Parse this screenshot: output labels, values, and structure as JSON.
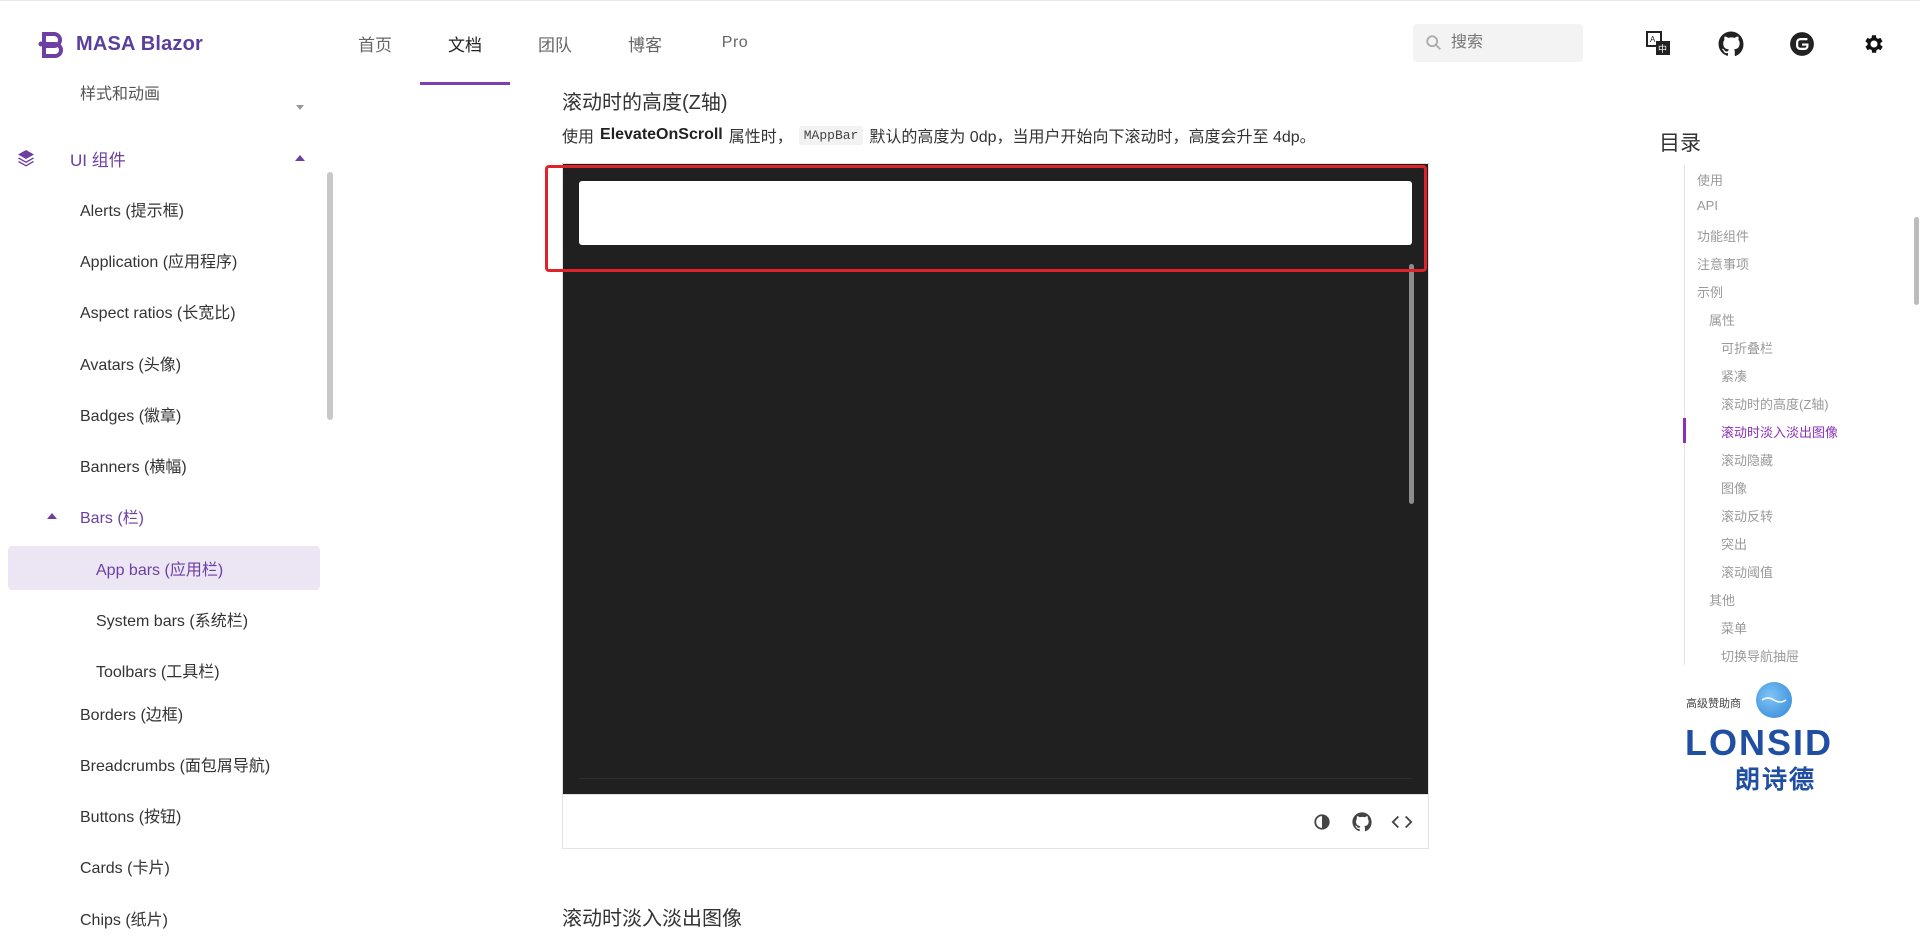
{
  "header": {
    "logo_text": "MASA Blazor",
    "nav": [
      {
        "label": "首页",
        "active": false
      },
      {
        "label": "文档",
        "active": true
      },
      {
        "label": "团队",
        "active": false
      },
      {
        "label": "博客",
        "active": false
      },
      {
        "label": "Pro",
        "active": false
      }
    ],
    "search_placeholder": "搜索",
    "icons": [
      "translate-icon",
      "github-icon",
      "gitee-icon",
      "gear-icon"
    ],
    "accent_color": "#7a3fb3"
  },
  "sidebar": {
    "partial_item": "样式和动画",
    "group": {
      "label": "UI 组件",
      "expanded": true
    },
    "items": [
      "Alerts (提示框)",
      "Application (应用程序)",
      "Aspect ratios (长宽比)",
      "Avatars (头像)",
      "Badges (徽章)",
      "Banners (横幅)"
    ],
    "bars": {
      "label": "Bars (栏)",
      "children": [
        "App bars (应用栏)",
        "System bars (系统栏)",
        "Toolbars (工具栏)"
      ],
      "selected": "App bars (应用栏)"
    },
    "items_after": [
      "Borders (边框)",
      "Breadcrumbs (面包屑导航)",
      "Buttons (按钮)",
      "Cards (卡片)",
      "Chips (纸片)"
    ]
  },
  "main": {
    "section_title": "滚动时的高度(Z轴)",
    "desc_prefix": "使用",
    "desc_strong": "ElevateOnScroll",
    "desc_mid": "属性时，",
    "desc_code": "MAppBar",
    "desc_suffix": "默认的高度为 0dp，当用户开始向下滚动时，高度会升至 4dp。",
    "toolbar_icons": [
      "theme-toggle-icon",
      "github-icon",
      "code-icon"
    ],
    "next_section_title": "滚动时淡入淡出图像"
  },
  "toc": {
    "title": "目录",
    "items": [
      {
        "label": "使用",
        "level": 1
      },
      {
        "label": "API",
        "level": 1
      },
      {
        "label": "功能组件",
        "level": 1
      },
      {
        "label": "注意事项",
        "level": 1
      },
      {
        "label": "示例",
        "level": 1
      },
      {
        "label": "属性",
        "level": 2
      },
      {
        "label": "可折叠栏",
        "level": 3
      },
      {
        "label": "紧凑",
        "level": 3
      },
      {
        "label": "滚动时的高度(Z轴)",
        "level": 3
      },
      {
        "label": "滚动时淡入淡出图像",
        "level": 3,
        "active": true
      },
      {
        "label": "滚动隐藏",
        "level": 3
      },
      {
        "label": "图像",
        "level": 3
      },
      {
        "label": "滚动反转",
        "level": 3
      },
      {
        "label": "突出",
        "level": 3
      },
      {
        "label": "滚动阈值",
        "level": 3
      },
      {
        "label": "其他",
        "level": 2
      },
      {
        "label": "菜单",
        "level": 3
      },
      {
        "label": "切换导航抽屉",
        "level": 3
      }
    ]
  },
  "sponsor": {
    "label": "高级赞助商",
    "brand_latin": "LONSID",
    "brand_cn": "朗诗德"
  }
}
